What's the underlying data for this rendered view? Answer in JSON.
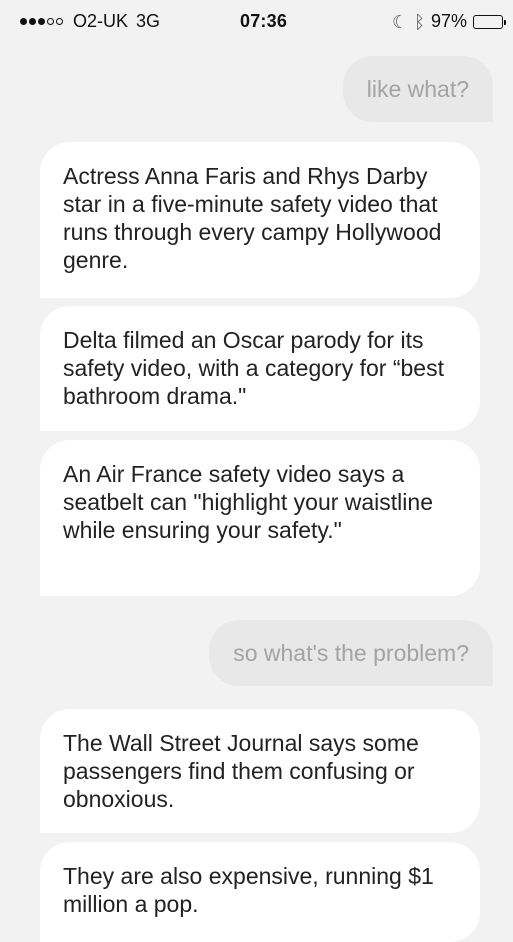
{
  "status_bar": {
    "carrier": "O2-UK",
    "network": "3G",
    "time": "07:36",
    "battery_percent": "97%",
    "battery_level": 0.97,
    "battery_color": "#f7c300",
    "icons": [
      "signal-dots",
      "moon-icon",
      "bluetooth-icon",
      "battery-icon"
    ]
  },
  "chat": {
    "messages": [
      {
        "sender": "user",
        "text": "like what?"
      },
      {
        "sender": "bot",
        "text": "Actress Anna Faris and Rhys Darby star in a five-minute safety video that runs through every campy Hollywood genre."
      },
      {
        "sender": "bot",
        "text": "Delta filmed an Oscar parody for its safety video, with a category for “best bathroom drama.\""
      },
      {
        "sender": "bot",
        "text": "An Air France safety video says a seatbelt can \"highlight your waistline while ensuring your safety.\""
      },
      {
        "sender": "user",
        "text": "so what's the problem?"
      },
      {
        "sender": "bot",
        "text": "The Wall Street Journal says some passengers find them confusing or obnoxious."
      },
      {
        "sender": "bot",
        "text": "They are also expensive, running $1 million a pop."
      }
    ]
  }
}
